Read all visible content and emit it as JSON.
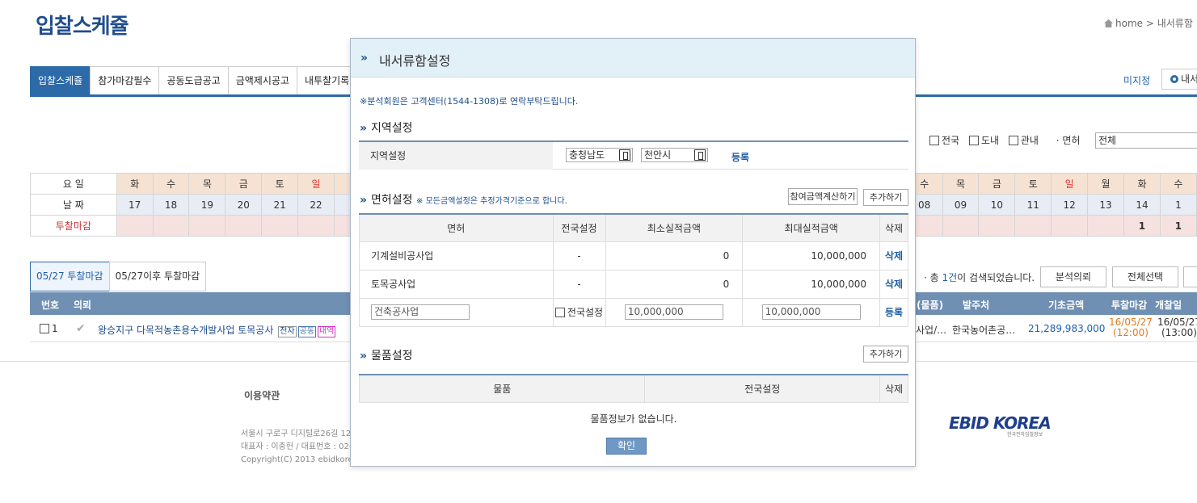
{
  "page": {
    "title": "입찰스케쥴",
    "breadcrumb": "home > 내서류함 >"
  },
  "tabs": [
    "입찰스케쥴",
    "참가마감필수",
    "공동도급공고",
    "금액제시공고",
    "내투찰기록"
  ],
  "toolbar": {
    "unassigned": "미지정",
    "settings_label": "내서"
  },
  "filters": {
    "options": [
      "전국",
      "도내",
      "관내"
    ],
    "license_label": "· 면허",
    "license_value": "전체"
  },
  "calendar": {
    "labels": [
      "요 일",
      "날 짜",
      "투찰마감"
    ],
    "left_days": [
      "화",
      "수",
      "목",
      "금",
      "토",
      "일"
    ],
    "left_dates": [
      "17",
      "18",
      "19",
      "20",
      "21",
      "22"
    ],
    "right_days": [
      "수",
      "목",
      "금",
      "토",
      "일",
      "월",
      "화",
      "수"
    ],
    "right_dates": [
      "08",
      "09",
      "10",
      "11",
      "12",
      "13",
      "14",
      "1"
    ],
    "right_counts": [
      "",
      "",
      "",
      "",
      "",
      "",
      "1",
      "1"
    ]
  },
  "subtabs": [
    "05/27 투찰마감",
    "05/27이후 투찰마감"
  ],
  "result": {
    "prefix": "· 총 ",
    "count": "1건",
    "suffix": "이 검색되었습니다.",
    "btn_analysis": "분석의뢰",
    "btn_select_all": "전체선택"
  },
  "list_header": {
    "no": "번호",
    "request": "의뢰",
    "goods": "(물품)",
    "client": "발주처",
    "base": "기초금액",
    "close": "투찰마감",
    "open": "개찰일"
  },
  "list_row": {
    "no": "1",
    "title": "왕승지구 다목적농촌용수개발사업 토목공사",
    "badges": [
      "전자",
      "공동",
      "내역"
    ],
    "goods": "사업/…",
    "client": "한국농어촌공…",
    "base": "21,289,983,000",
    "close_date": "16/05/27",
    "close_time": "(12:00)",
    "open_date": "16/05/27",
    "open_time": "(13:00)"
  },
  "footer": {
    "terms": "이용약관",
    "addr1": "서울시 구로구 디지털로26길 12",
    "addr2": "대표자 : 이충헌 / 대표번호 : 02-",
    "addr3": "Copyright(C) 2013 ebidkorea",
    "logo": "EBID KOREA",
    "logo_sub": "한국전자입찰정보"
  },
  "modal": {
    "title": "내서류함설정",
    "notice": "※분석회원은 고객센터(1544-1308)로 연락부탁드립니다.",
    "region": {
      "section_title": "지역설정",
      "label": "지역설정",
      "province": "충청남도",
      "city": "천안시",
      "register": "등록"
    },
    "license": {
      "section_title": "면허설정",
      "note": "※ 모든금액설정은 추정가격기준으로 합니다.",
      "btn_calc": "참여금액계산하기",
      "btn_add": "추가하기",
      "headers": [
        "면허",
        "전국설정",
        "최소실적금액",
        "최대실적금액",
        "삭제"
      ],
      "rows": [
        {
          "name": "기계설비공사업",
          "national": "-",
          "min": "0",
          "max": "10,000,000",
          "action": "삭제"
        },
        {
          "name": "토목공사업",
          "national": "-",
          "min": "0",
          "max": "10,000,000",
          "action": "삭제"
        }
      ],
      "new_row": {
        "name": "건축공사업",
        "national": "전국설정",
        "min": "10,000,000",
        "max": "10,000,000",
        "action": "등록"
      }
    },
    "goods": {
      "section_title": "물품설정",
      "btn_add": "추가하기",
      "headers": [
        "물품",
        "전국설정",
        "삭제"
      ],
      "empty": "물품정보가 없습니다."
    },
    "ok": "확인"
  }
}
